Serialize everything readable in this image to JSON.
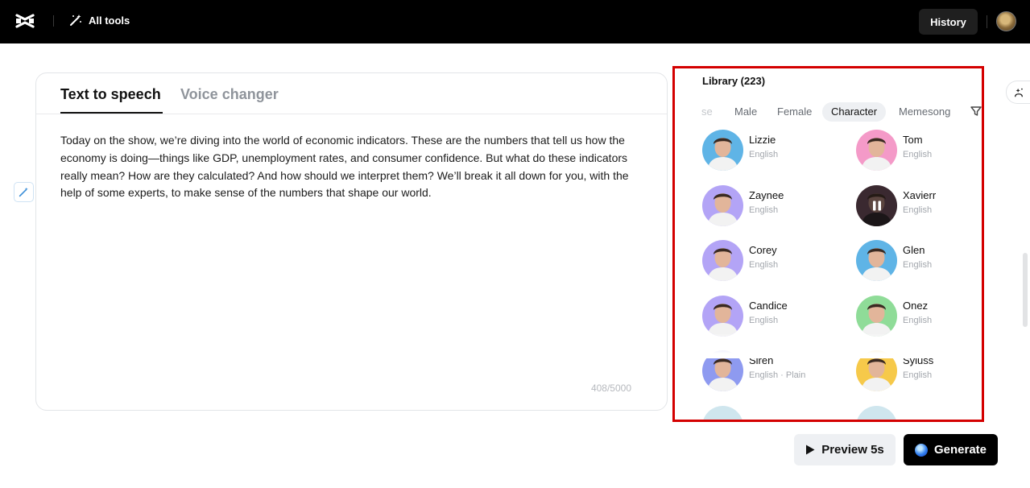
{
  "header": {
    "all_tools_label": "All tools",
    "history_label": "History"
  },
  "editor": {
    "tabs": [
      {
        "label": "Text to speech",
        "active": true
      },
      {
        "label": "Voice changer",
        "active": false
      }
    ],
    "text": "Today on the show, we’re diving into the world of economic indicators. These are the numbers that tell us how the economy is doing—things like GDP, unemployment rates, and consumer confidence. But what do these indicators really mean? How are they calculated? And how should we interpret them? We’ll break it all down for you, with the help of some experts, to make sense of the numbers that shape our world.",
    "char_count": "408/5000"
  },
  "library": {
    "title": "Library (223)",
    "filters": [
      {
        "label": "se",
        "active": false
      },
      {
        "label": "Male",
        "active": false
      },
      {
        "label": "Female",
        "active": false
      },
      {
        "label": "Character",
        "active": true
      },
      {
        "label": "Memesong",
        "active": false
      }
    ],
    "voices": [
      {
        "name": "Lizzie",
        "lang": "English",
        "color": "#5fb4e6"
      },
      {
        "name": "Tom",
        "lang": "English",
        "color": "#f49ac8"
      },
      {
        "name": "Zaynee",
        "lang": "English",
        "color": "#b3a4f6"
      },
      {
        "name": "Xavierr",
        "lang": "English",
        "color": "#5a3f4a",
        "playing": true
      },
      {
        "name": "Corey",
        "lang": "English",
        "color": "#b3a4f6"
      },
      {
        "name": "Glen",
        "lang": "English",
        "color": "#5fb4e6"
      },
      {
        "name": "Candice",
        "lang": "English",
        "color": "#b3a4f6"
      },
      {
        "name": "Onez",
        "lang": "English",
        "color": "#8fdc98"
      },
      {
        "name": "Siren",
        "lang": "English · Plain",
        "color": "#8e9af0"
      },
      {
        "name": "Syluss",
        "lang": "English",
        "color": "#f6c94a"
      }
    ]
  },
  "actions": {
    "preview_label": "Preview 5s",
    "generate_label": "Generate"
  }
}
